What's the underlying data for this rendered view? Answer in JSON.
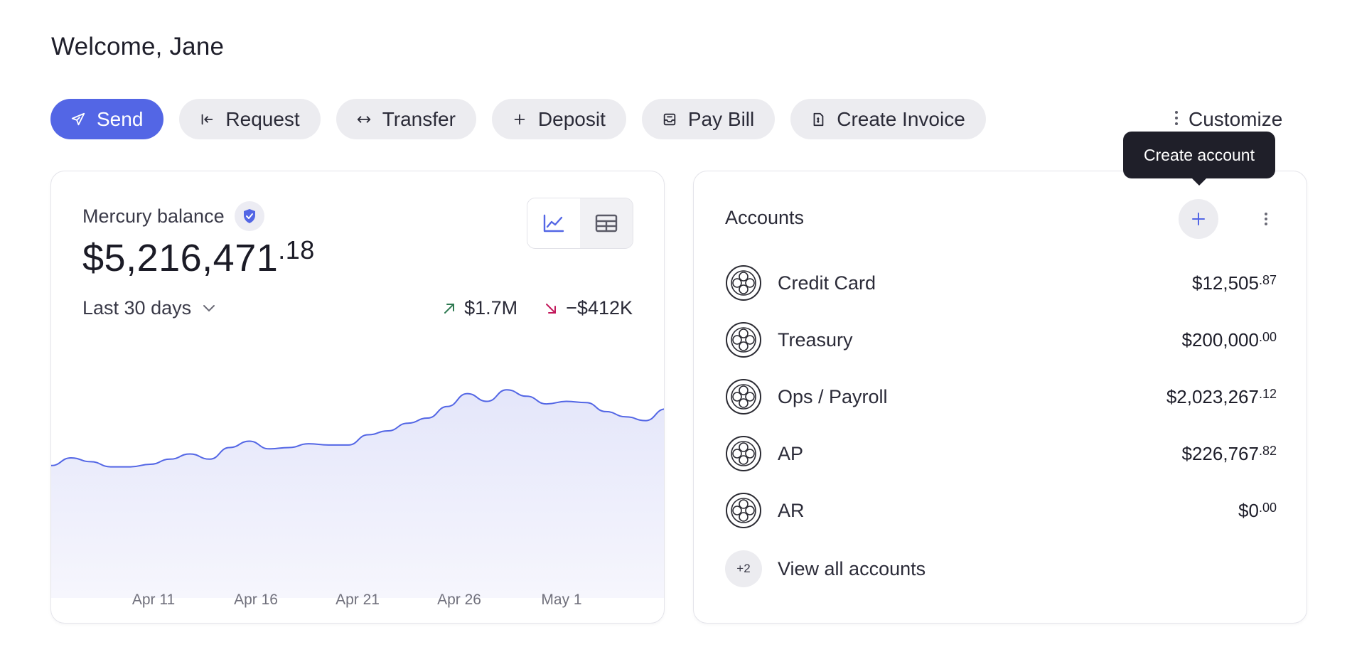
{
  "welcome": "Welcome, Jane",
  "actions": [
    {
      "label": "Send",
      "icon": "send-icon"
    },
    {
      "label": "Request",
      "icon": "request-icon"
    },
    {
      "label": "Transfer",
      "icon": "transfer-icon"
    },
    {
      "label": "Deposit",
      "icon": "plus-icon"
    },
    {
      "label": "Pay Bill",
      "icon": "pay-bill-icon"
    },
    {
      "label": "Create Invoice",
      "icon": "invoice-icon"
    }
  ],
  "customize": {
    "label": "Customize",
    "icon": "vertical-dots-icon"
  },
  "balance": {
    "label": "Mercury balance",
    "amount_main": "$5,216,471",
    "amount_cents": ".18",
    "period": "Last 30 days",
    "inflow": "$1.7M",
    "outflow": "−$412K",
    "inflow_color": "#2f7a52",
    "outflow_color": "#c2185b",
    "view_options": [
      "line-chart-icon",
      "table-icon"
    ]
  },
  "chart_data": {
    "type": "area",
    "x_ticks": [
      "Apr 11",
      "Apr 16",
      "Apr 21",
      "Apr 26",
      "May 1"
    ],
    "values": [
      4.22,
      4.28,
      4.25,
      4.21,
      4.21,
      4.23,
      4.27,
      4.31,
      4.27,
      4.36,
      4.41,
      4.35,
      4.36,
      4.39,
      4.38,
      4.38,
      4.46,
      4.49,
      4.55,
      4.59,
      4.68,
      4.78,
      4.72,
      4.81,
      4.76,
      4.7,
      4.72,
      4.71,
      4.64,
      4.6,
      4.57,
      4.66
    ],
    "series_color": "#5366e5",
    "fill_color": "#e9eafa",
    "grid": false
  },
  "accounts": {
    "title": "Accounts",
    "add_tooltip": "Create account",
    "items": [
      {
        "name": "Credit Card",
        "amount": "$12,505",
        "cents": ".87"
      },
      {
        "name": "Treasury",
        "amount": "$200,000",
        "cents": ".00"
      },
      {
        "name": "Ops / Payroll",
        "amount": "$2,023,267",
        "cents": ".12"
      },
      {
        "name": "AP",
        "amount": "$226,767",
        "cents": ".82"
      },
      {
        "name": "AR",
        "amount": "$0",
        "cents": ".00"
      }
    ],
    "more_count": "+2",
    "view_all": "View all accounts"
  },
  "colors": {
    "accent": "#5366e5",
    "chip_bg": "#ececf0"
  }
}
